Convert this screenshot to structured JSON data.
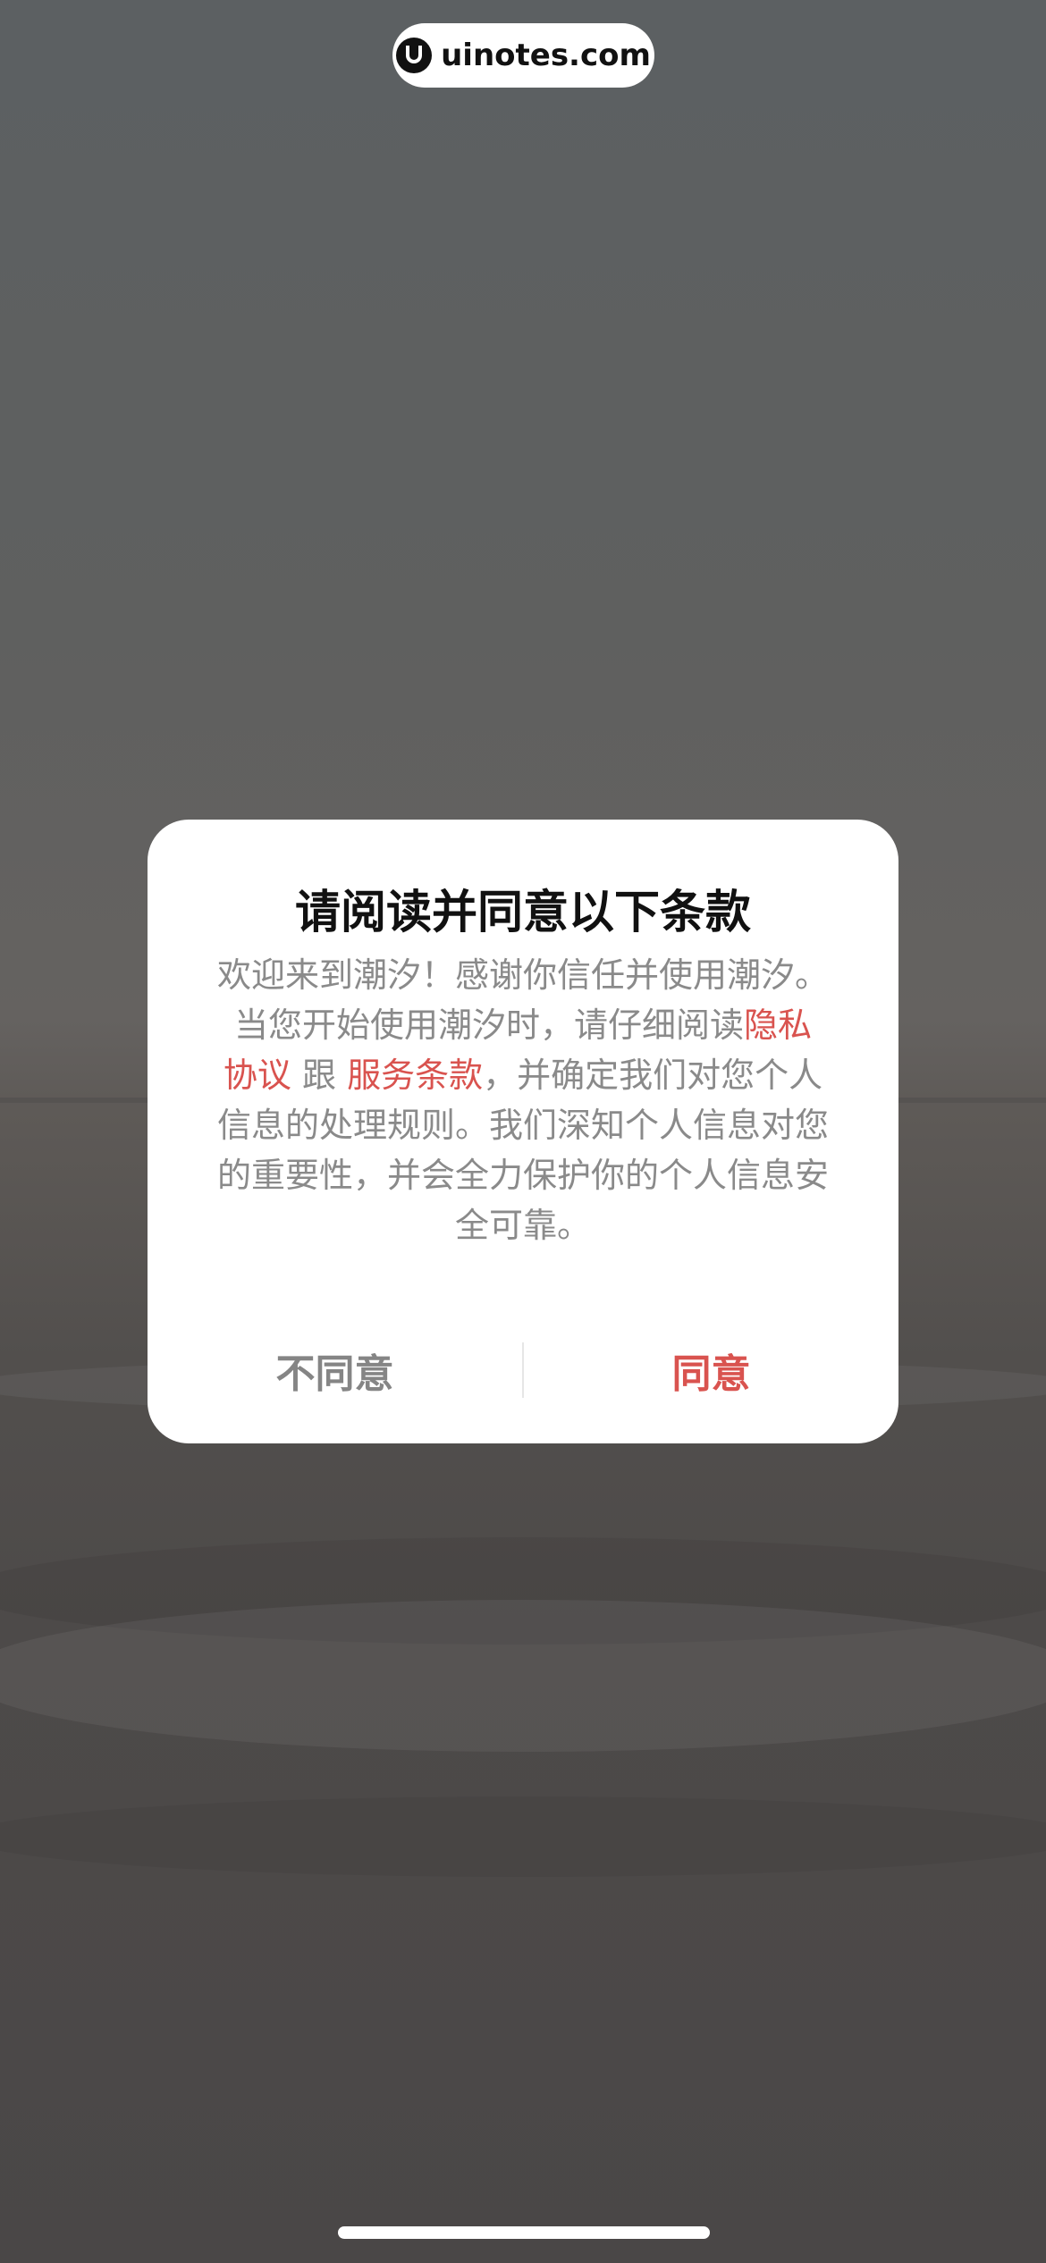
{
  "watermark": {
    "text": "uinotes.com"
  },
  "dialog": {
    "title": "请阅读并同意以下条款",
    "body_part1": "欢迎来到潮汐！感谢你信任并使用潮汐。当您开始使用潮汐时，请仔细阅读",
    "privacy_link": "隐私协议",
    "connector": " 跟 ",
    "terms_link": "服务条款",
    "body_part2": "，并确定我们对您个人信息的处理规则。我们深知个人信息对您的重要性，并会全力保护你的个人信息安全可靠。",
    "disagree_label": "不同意",
    "agree_label": "同意"
  },
  "colors": {
    "accent": "#d9534f",
    "body_text": "#8a8a8a",
    "title_text": "#111111",
    "disagree_text": "#858585",
    "dialog_bg": "#ffffff"
  },
  "icons": {
    "watermark_logo": "uinotes-logo-icon"
  }
}
